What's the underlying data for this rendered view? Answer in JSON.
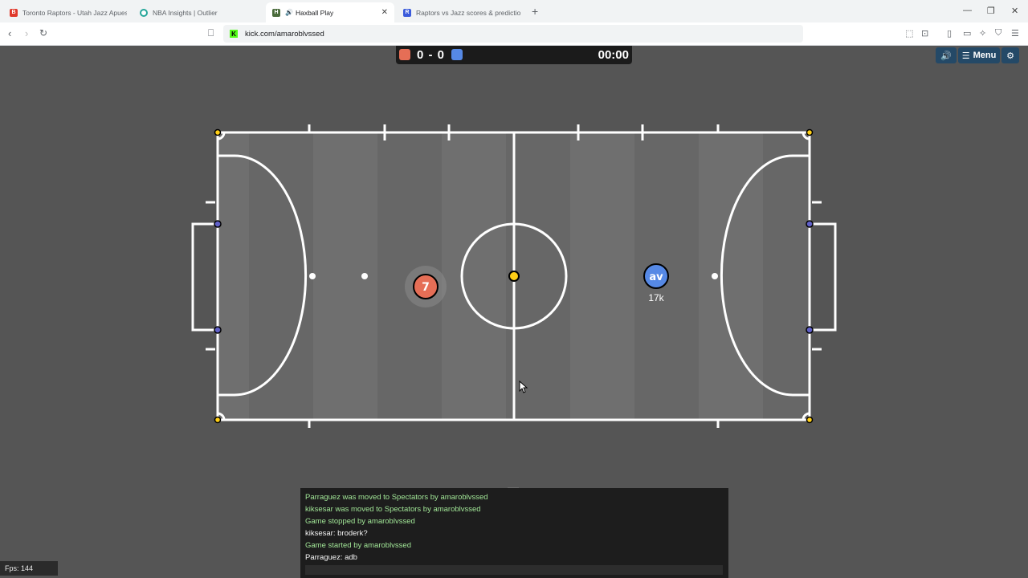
{
  "browser": {
    "tabs": [
      {
        "title": "Toronto Raptors - Utah Jazz Apuesta",
        "favicon_color": "#e0392b",
        "favicon_glyph": "B"
      },
      {
        "title": "NBA Insights | Outlier",
        "favicon_color": "#26a69a",
        "favicon_glyph": "O"
      },
      {
        "title": "Haxball Play",
        "favicon_color": "#4a6b3b",
        "favicon_glyph": "H",
        "active": true
      },
      {
        "title": "Raptors vs Jazz scores & predictions",
        "favicon_color": "#3b5bdb",
        "favicon_glyph": "R"
      }
    ],
    "url": "kick.com/amaroblvssed"
  },
  "game": {
    "score": "0 - 0",
    "time": "00:00",
    "controls": {
      "sound_icon": "speaker-icon",
      "menu_label": "Menu",
      "settings_icon": "gear-icon"
    },
    "players": [
      {
        "team": "red",
        "avatar": "7",
        "color": "#e56e56"
      },
      {
        "team": "blue",
        "avatar": "av",
        "name": "17k",
        "color": "#5689e5"
      }
    ],
    "ball_color": "#ffcf16"
  },
  "chat": {
    "messages": [
      {
        "text": "Parraguez was moved to Spectators by amaroblvssed",
        "kind": "sys"
      },
      {
        "text": "kiksesar was moved to Spectators by amaroblvssed",
        "kind": "sys"
      },
      {
        "text": "Game stopped by amaroblvssed",
        "kind": "sys"
      },
      {
        "text": "kiksesar: broderk?",
        "kind": "usr"
      },
      {
        "text": "Game started by amaroblvssed",
        "kind": "sys"
      },
      {
        "text": "Parraguez: adb",
        "kind": "usr"
      }
    ]
  },
  "fps_label": "Fps: 144"
}
